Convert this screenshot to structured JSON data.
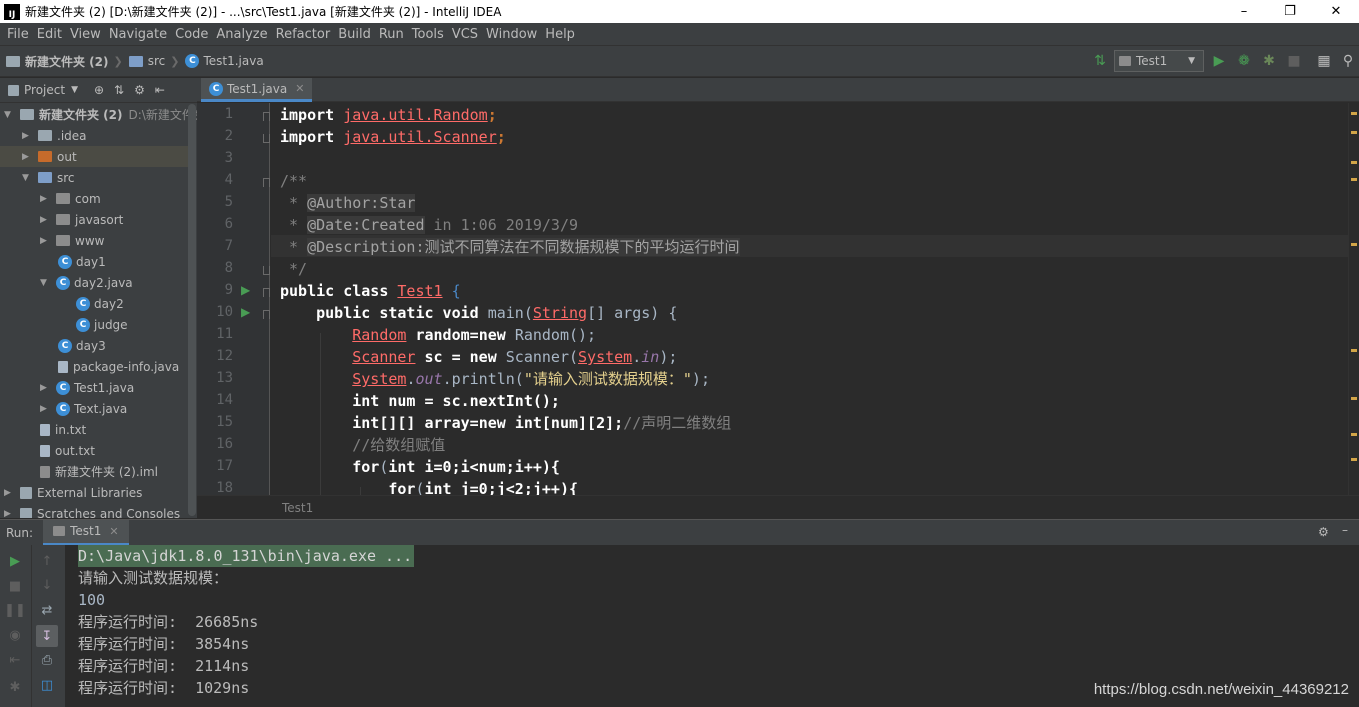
{
  "window": {
    "title": "新建文件夹 (2) [D:\\新建文件夹 (2)] - ...\\src\\Test1.java [新建文件夹 (2)] - IntelliJ IDEA",
    "logo": "IJ"
  },
  "menu": [
    "File",
    "Edit",
    "View",
    "Navigate",
    "Code",
    "Analyze",
    "Refactor",
    "Build",
    "Run",
    "Tools",
    "VCS",
    "Window",
    "Help"
  ],
  "breadcrumb": [
    "新建文件夹 (2)",
    "src",
    "Test1.java"
  ],
  "run_config": "Test1",
  "project_panel": {
    "title": "Project",
    "items": [
      {
        "label": "新建文件夹 (2)",
        "hint": "D:\\新建文件夹",
        "icon": "folder"
      },
      {
        "label": ".idea",
        "icon": "folder"
      },
      {
        "label": "out",
        "icon": "folder-orange"
      },
      {
        "label": "src",
        "icon": "folder"
      },
      {
        "label": "com",
        "icon": "package"
      },
      {
        "label": "javasort",
        "icon": "package"
      },
      {
        "label": "www",
        "icon": "package"
      },
      {
        "label": "day1",
        "icon": "class"
      },
      {
        "label": "day2.java",
        "icon": "class"
      },
      {
        "label": "day2",
        "icon": "class"
      },
      {
        "label": "judge",
        "icon": "class"
      },
      {
        "label": "day3",
        "icon": "class"
      },
      {
        "label": "package-info.java",
        "icon": "file"
      },
      {
        "label": "Test1.java",
        "icon": "class"
      },
      {
        "label": "Text.java",
        "icon": "class"
      },
      {
        "label": "in.txt",
        "icon": "text-file"
      },
      {
        "label": "out.txt",
        "icon": "text-file"
      },
      {
        "label": "新建文件夹 (2).iml",
        "icon": "module-file"
      },
      {
        "label": "External Libraries",
        "icon": "library"
      },
      {
        "label": "Scratches and Consoles",
        "icon": "scratches"
      }
    ]
  },
  "editor": {
    "tab": "Test1.java",
    "footer": "Test1",
    "line_numbers": [
      "1",
      "2",
      "3",
      "4",
      "5",
      "6",
      "7",
      "8",
      "9",
      "10",
      "11",
      "12",
      "13",
      "14",
      "15",
      "16",
      "17",
      "18"
    ],
    "lines": {
      "l1a": "import ",
      "l1b": "java.util.Random",
      ";": ";",
      "l2a": "import ",
      "l2b": "java.util.Scanner",
      "l4": "/**",
      "l5a": " * ",
      "l5b": "@Author:Star",
      "l6a": " * ",
      "l6b": "@Date:Created",
      " l6c": " in 1:06 2019/3/9",
      "l7a": " * ",
      "l7b": "@Description:",
      "l7c": "测试不同算法在不同数据规模下的平均运行时间",
      "l8": " */",
      "l9a": "public class ",
      "l9b": "Test1",
      " l9c": " {",
      "l10a": "    public static void ",
      "l10b": "main(",
      "l10c": "String",
      "l10d": "[] args) {",
      "l11a": "        ",
      "l11b": "Random",
      " l11c": " random=",
      "l11d": "new ",
      "l11e": "Random();",
      "l12a": "        ",
      "l12b": "Scanner",
      " l12c": " sc = ",
      "l12d": "new ",
      "l12e": "Scanner(",
      "l12f": "System",
      ".": ".",
      "l12g": "in",
      ");": ");",
      "l13a": "        ",
      "l13b": "System",
      ".o": ".",
      "l13c": "out",
      "l13d": ".println(",
      "l13e": "\"请输入测试数据规模：\"",
      "l13f": ");",
      "l14a": "        ",
      "l14b": "int ",
      "l14c": "num = sc.nextInt();",
      "l15a": "        ",
      "l15b": "int",
      "l15c": "[][] array=",
      "l15d": "new ",
      "l15e": "int",
      "l15f": "[num][2];",
      "l15g": "//声明二维数组",
      "l16a": "        ",
      "l16b": "//给数组赋值",
      "l17a": "        ",
      "l17b": "for",
      "l17c": "(",
      "l17d": "int ",
      "l17e": "i=0;i<num;i++){",
      "l18a": "            ",
      "l18b": "for",
      "l18c": "(",
      "l18d": "int ",
      "l18e": "j=0;j<2;j++){"
    }
  },
  "run": {
    "label": "Run:",
    "tab": "Test1",
    "console": [
      "D:\\Java\\jdk1.8.0_131\\bin\\java.exe ...",
      "请输入测试数据规模：",
      "100",
      "程序运行时间:  26685ns",
      "程序运行时间:  3854ns",
      "程序运行时间:  2114ns",
      "程序运行时间:  1029ns"
    ]
  },
  "watermark": "https://blog.csdn.net/weixin_44369212",
  "colors": {
    "accent": "#4a88c7",
    "run_green": "#499c54",
    "keyword": "#cc7832",
    "error_underline": "#ff6b68"
  }
}
